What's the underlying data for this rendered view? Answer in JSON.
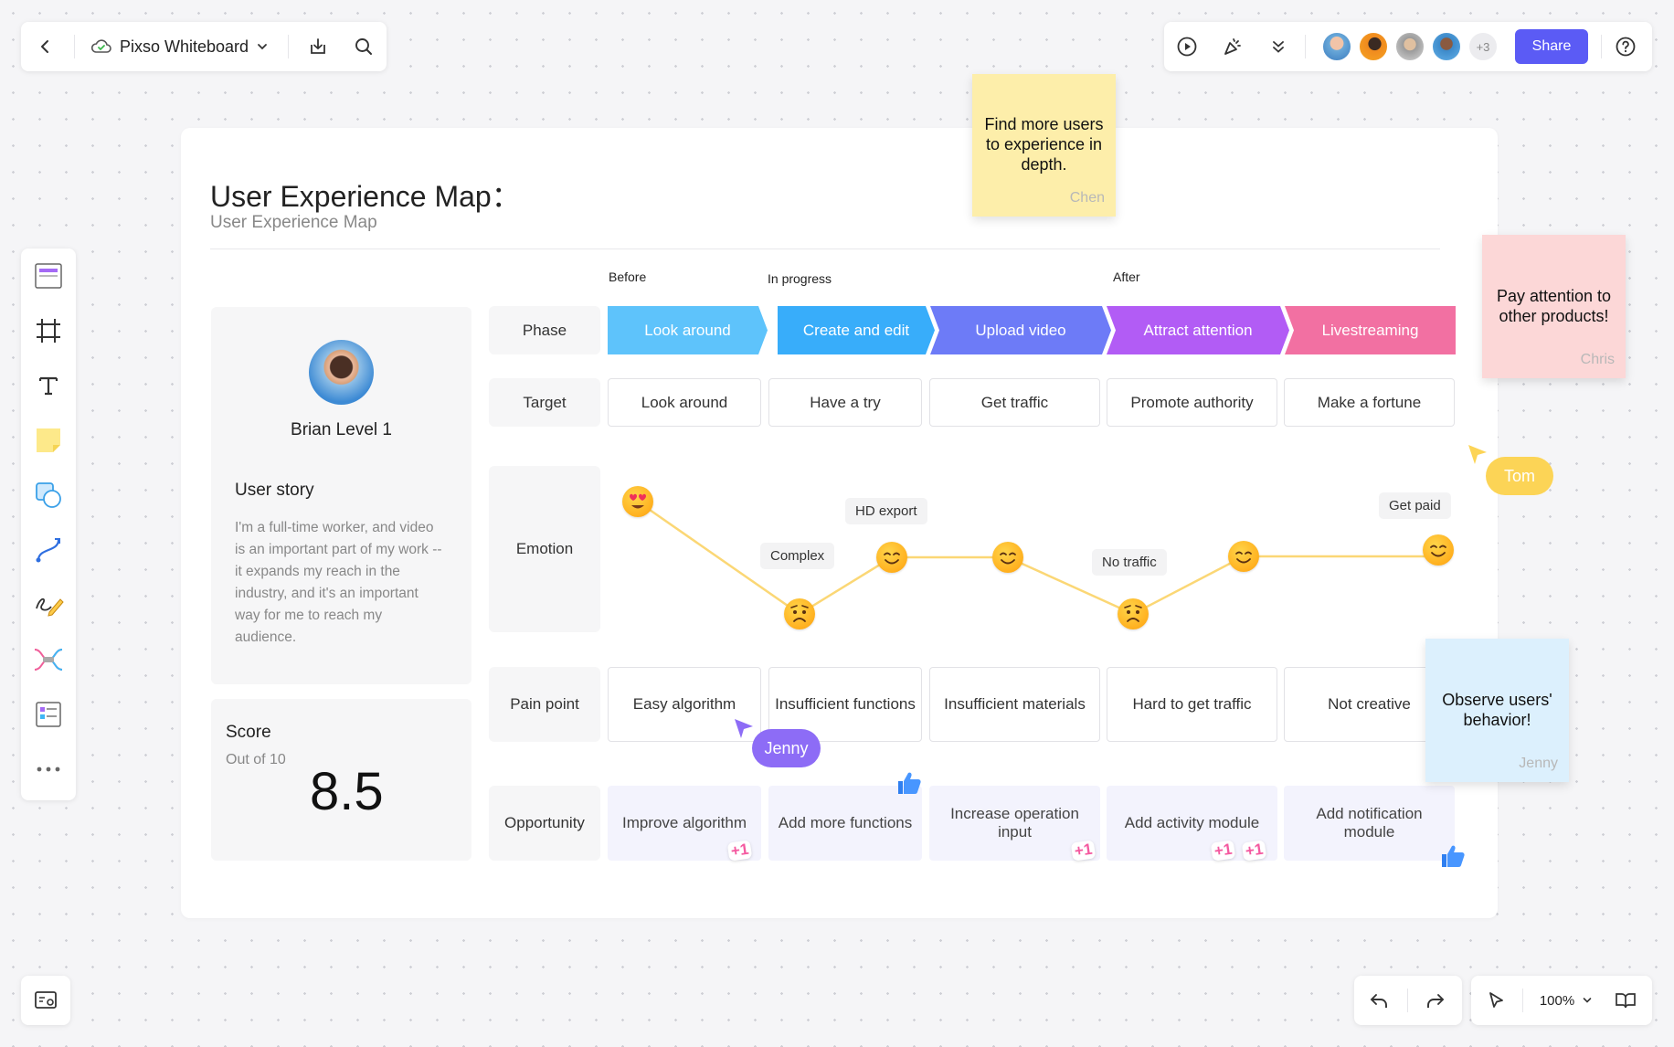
{
  "topbar": {
    "file_name": "Pixso Whiteboard",
    "share_label": "Share",
    "extra_collaborators": "+3"
  },
  "board": {
    "title": "User Experience Map：",
    "subtitle": "User Experience Map",
    "stages": [
      "Before",
      "In progress",
      "After"
    ],
    "row_labels": {
      "phase": "Phase",
      "target": "Target",
      "emotion": "Emotion",
      "pain_point": "Pain point",
      "opportunity": "Opportunity"
    },
    "phases": [
      {
        "label": "Look around",
        "color": "#5ec3fb"
      },
      {
        "label": "Create and edit",
        "color": "#38adfa"
      },
      {
        "label": "Upload video",
        "color": "#6d7bf7"
      },
      {
        "label": "Attract attention",
        "color": "#b25cf5"
      },
      {
        "label": "Livestreaming",
        "color": "#f270a2"
      }
    ],
    "targets": [
      "Look around",
      "Have a try",
      "Get traffic",
      "Promote authority",
      "Make a fortune"
    ],
    "emotion_labels": [
      "Complex",
      "HD export",
      "No traffic",
      "Get paid"
    ],
    "emotion_icons": [
      "heart-eyes-emoji-icon",
      "worried-emoji-icon",
      "smile-emoji-icon",
      "smile-emoji-icon",
      "worried-emoji-icon",
      "smile-emoji-icon",
      "smile-emoji-icon"
    ],
    "pain_points": [
      "Easy algorithm",
      "Insufficient functions",
      "Insufficient materials",
      "Hard to get traffic",
      "Not creative"
    ],
    "opportunities": [
      "Improve algorithm",
      "Add more functions",
      "Increase operation input",
      "Add activity module",
      "Add notification module"
    ],
    "vote": "+1"
  },
  "persona": {
    "name": "Brian Level 1",
    "story_title": "User story",
    "story_text": "I'm a full-time worker, and video is an important part of my work -- it expands my reach in the industry, and it's an important way for me to reach my audience."
  },
  "score": {
    "title": "Score",
    "subtitle": "Out of 10",
    "value": "8.5"
  },
  "stickies": [
    {
      "text": "Find more users to experience in depth.",
      "author": "Chen",
      "color": "#fdeeaa"
    },
    {
      "text": "Pay attention to other products!",
      "author": "Chris",
      "color": "#fcd7d7"
    },
    {
      "text": "Observe users' behavior!",
      "author": "Jenny",
      "color": "#dcf0fd"
    }
  ],
  "cursors": [
    {
      "name": "Tom",
      "color": "#fcd456"
    },
    {
      "name": "Jenny",
      "color": "#8d6cf6"
    }
  ],
  "zoom": "100%",
  "colors": {
    "accent": "#5b5bf5"
  }
}
